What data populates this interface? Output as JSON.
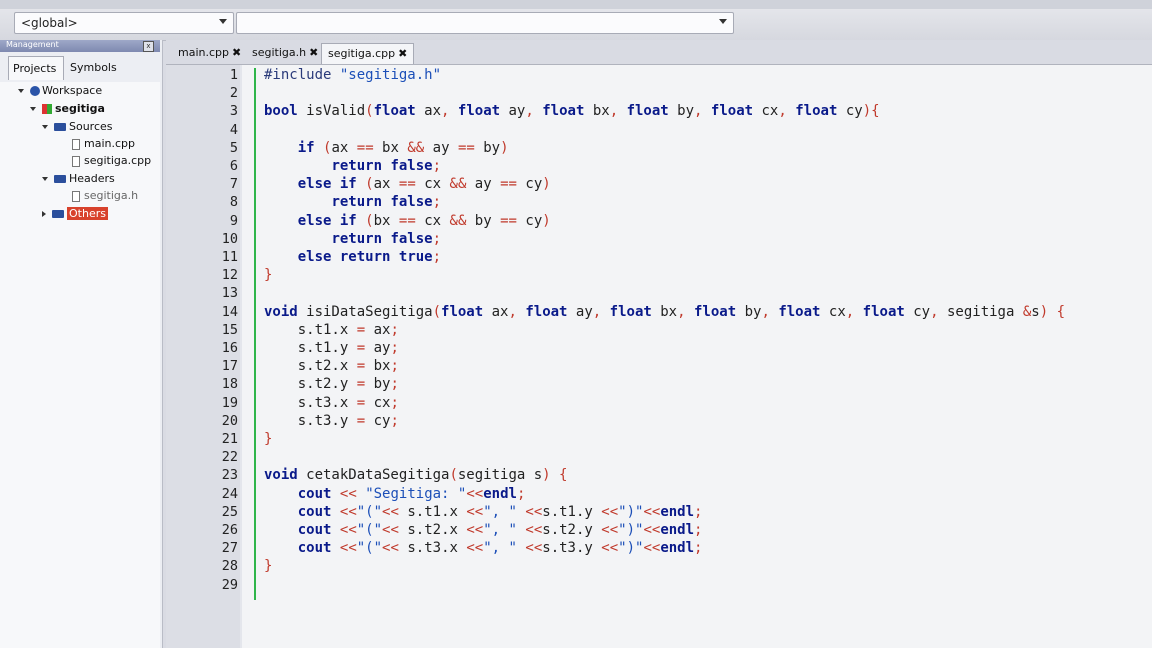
{
  "toolbar": {
    "scope_combo": "<global>",
    "symbol_combo": ""
  },
  "management": {
    "title": "Management",
    "tabs": [
      "Projects",
      "Symbols"
    ],
    "tree": {
      "workspace": "Workspace",
      "project": "segitiga",
      "sources": "Sources",
      "source_files": [
        "main.cpp",
        "segitiga.cpp"
      ],
      "headers": "Headers",
      "header_files": [
        "segitiga.h"
      ],
      "others": "Others"
    }
  },
  "editor": {
    "tabs": [
      "main.cpp",
      "segitiga.h",
      "segitiga.cpp"
    ],
    "active_tab": "segitiga.cpp",
    "close_glyph": "✖",
    "line_numbers": [
      "1",
      "2",
      "3",
      "4",
      "5",
      "6",
      "7",
      "8",
      "9",
      "10",
      "11",
      "12",
      "13",
      "14",
      "15",
      "16",
      "17",
      "18",
      "19",
      "20",
      "21",
      "22",
      "23",
      "24",
      "25",
      "26",
      "27",
      "28",
      "29"
    ],
    "lines": [
      "#include \"segitiga.h\"",
      "",
      "bool isValid(float ax, float ay, float bx, float by, float cx, float cy){",
      "",
      "    if (ax == bx && ay == by)",
      "        return false;",
      "    else if (ax == cx && ay == cy)",
      "        return false;",
      "    else if (bx == cx && by == cy)",
      "        return false;",
      "    else return true;",
      "}",
      "",
      "void isiDataSegitiga(float ax, float ay, float bx, float by, float cx, float cy, segitiga &s) {",
      "    s.t1.x = ax;",
      "    s.t1.y = ay;",
      "    s.t2.x = bx;",
      "    s.t2.y = by;",
      "    s.t3.x = cx;",
      "    s.t3.y = cy;",
      "}",
      "",
      "void cetakDataSegitiga(segitiga s) {",
      "    cout << \"Segitiga: \"<<endl;",
      "    cout <<\"(\"<< s.t1.x <<\", \" <<s.t1.y <<\")\"<<endl;",
      "    cout <<\"(\"<< s.t2.x <<\", \" <<s.t2.y <<\")\"<<endl;",
      "    cout <<\"(\"<< s.t3.x <<\", \" <<s.t3.y <<\")\"<<endl;",
      "}",
      ""
    ]
  },
  "colors": {
    "accent_selected": "#d8422c",
    "change_marker": "#2fb54a",
    "keyword": "#0a1a8a",
    "operator": "#c0392b"
  }
}
